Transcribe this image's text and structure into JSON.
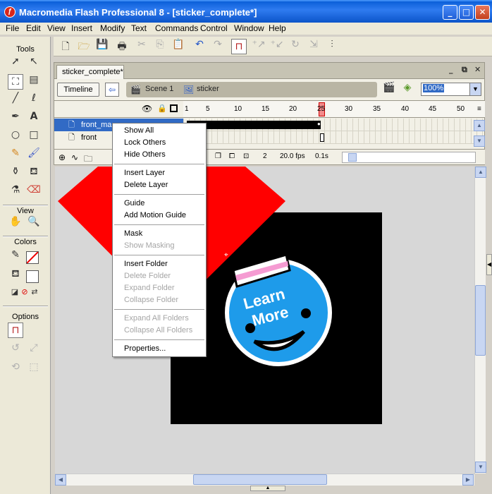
{
  "window": {
    "title": "Macromedia Flash Professional 8 - [sticker_complete*]",
    "minimize": "_",
    "maximize": "□",
    "close": "✕"
  },
  "menu": [
    "File",
    "Edit",
    "View",
    "Insert",
    "Modify",
    "Text",
    "Commands",
    "Control",
    "Window",
    "Help"
  ],
  "tools": {
    "label": "Tools",
    "view_label": "View",
    "colors_label": "Colors",
    "options_label": "Options"
  },
  "document": {
    "tab": "sticker_complete*"
  },
  "editbar": {
    "timeline": "Timeline",
    "scene": "Scene 1",
    "symbol": "sticker",
    "zoom": "100%"
  },
  "timeline": {
    "ruler": [
      "1",
      "5",
      "10",
      "15",
      "20",
      "25",
      "30",
      "35",
      "40",
      "45",
      "50"
    ],
    "layers": [
      {
        "name": "front_ma",
        "selected": true
      },
      {
        "name": "front",
        "selected": false
      }
    ],
    "current_frame": "2",
    "fps": "20.0 fps",
    "time": "0.1s"
  },
  "sticker": {
    "line1": "Learn",
    "line2": "More"
  },
  "context_menu": {
    "items": [
      {
        "label": "Show All",
        "enabled": true
      },
      {
        "label": "Lock Others",
        "enabled": true
      },
      {
        "label": "Hide Others",
        "enabled": true
      },
      {
        "label": "Insert Layer",
        "enabled": true
      },
      {
        "label": "Delete Layer",
        "enabled": true
      },
      {
        "label": "Guide",
        "enabled": true
      },
      {
        "label": "Add Motion Guide",
        "enabled": true
      },
      {
        "label": "Mask",
        "enabled": true
      },
      {
        "label": "Show Masking",
        "enabled": false
      },
      {
        "label": "Insert Folder",
        "enabled": true
      },
      {
        "label": "Delete Folder",
        "enabled": false
      },
      {
        "label": "Expand Folder",
        "enabled": false
      },
      {
        "label": "Collapse Folder",
        "enabled": false
      },
      {
        "label": "Expand All Folders",
        "enabled": false
      },
      {
        "label": "Collapse All Folders",
        "enabled": false
      },
      {
        "label": "Properties...",
        "enabled": true
      }
    ]
  },
  "colors": {
    "titlebar": "#0b54c9",
    "selection": "#316ac5",
    "stage": "#000000",
    "mask_shape": "#ff0000",
    "sticker_blue": "#1e9bea",
    "sticker_band": "#f59bd2"
  }
}
